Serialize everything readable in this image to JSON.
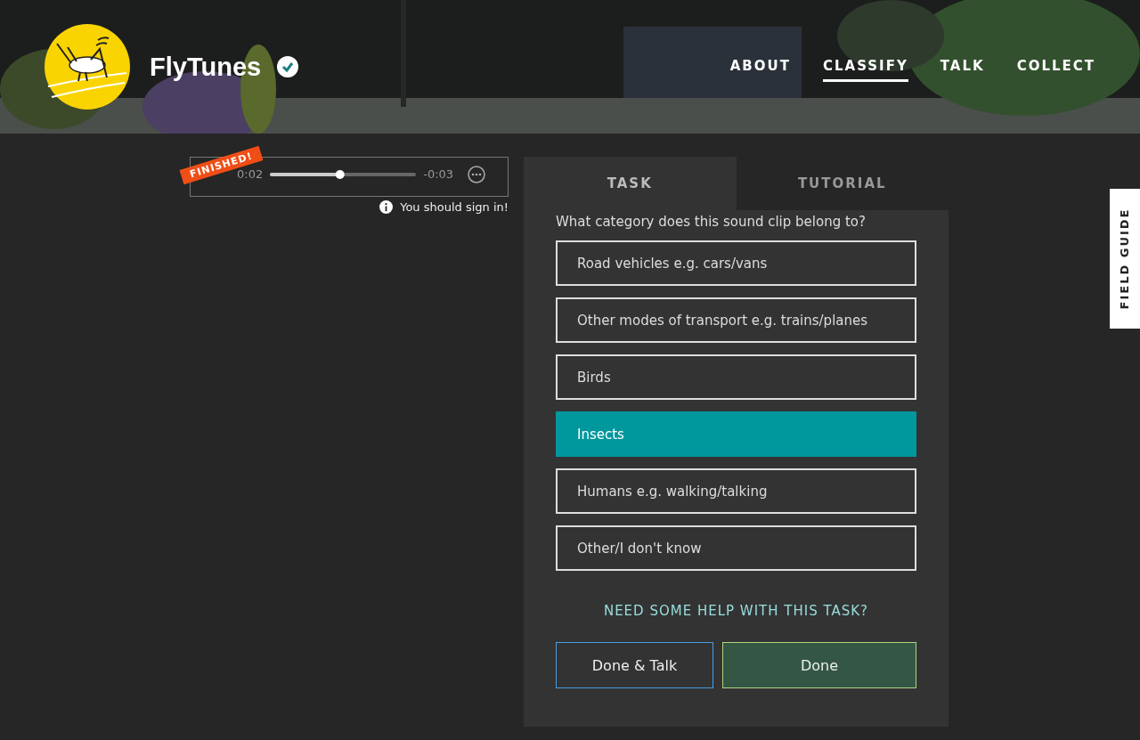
{
  "header": {
    "title": "FlyTunes",
    "verified": true,
    "nav": [
      {
        "label": "ABOUT",
        "selected": false
      },
      {
        "label": "CLASSIFY",
        "selected": true
      },
      {
        "label": "TALK",
        "selected": false
      },
      {
        "label": "COLLECT",
        "selected": false
      }
    ]
  },
  "player": {
    "badge": "FINISHED!",
    "elapsed": "0:02",
    "level": 0.48,
    "remaining": "-0:03",
    "notice": "You should sign in!"
  },
  "task_panel": {
    "tabs": [
      {
        "label": "TASK",
        "selected": true
      },
      {
        "label": "TUTORIAL",
        "selected": false
      }
    ],
    "question": "What category does this sound clip belong to?",
    "answers": [
      {
        "label": "Road vehicles e.g. cars/vans",
        "selected": false
      },
      {
        "label": "Other modes of transport e.g. trains/planes",
        "selected": false
      },
      {
        "label": "Birds",
        "selected": false
      },
      {
        "label": "Insects",
        "selected": true
      },
      {
        "label": "Humans e.g. walking/talking",
        "selected": false
      },
      {
        "label": "Other/I don't know",
        "selected": false
      }
    ],
    "help_link": "NEED SOME HELP WITH THIS TASK?",
    "buttons": [
      {
        "label": "Done & Talk",
        "kind": "secondary"
      },
      {
        "label": "Done",
        "kind": "primary"
      }
    ]
  },
  "field_guide": {
    "label": "FIELD GUIDE"
  }
}
